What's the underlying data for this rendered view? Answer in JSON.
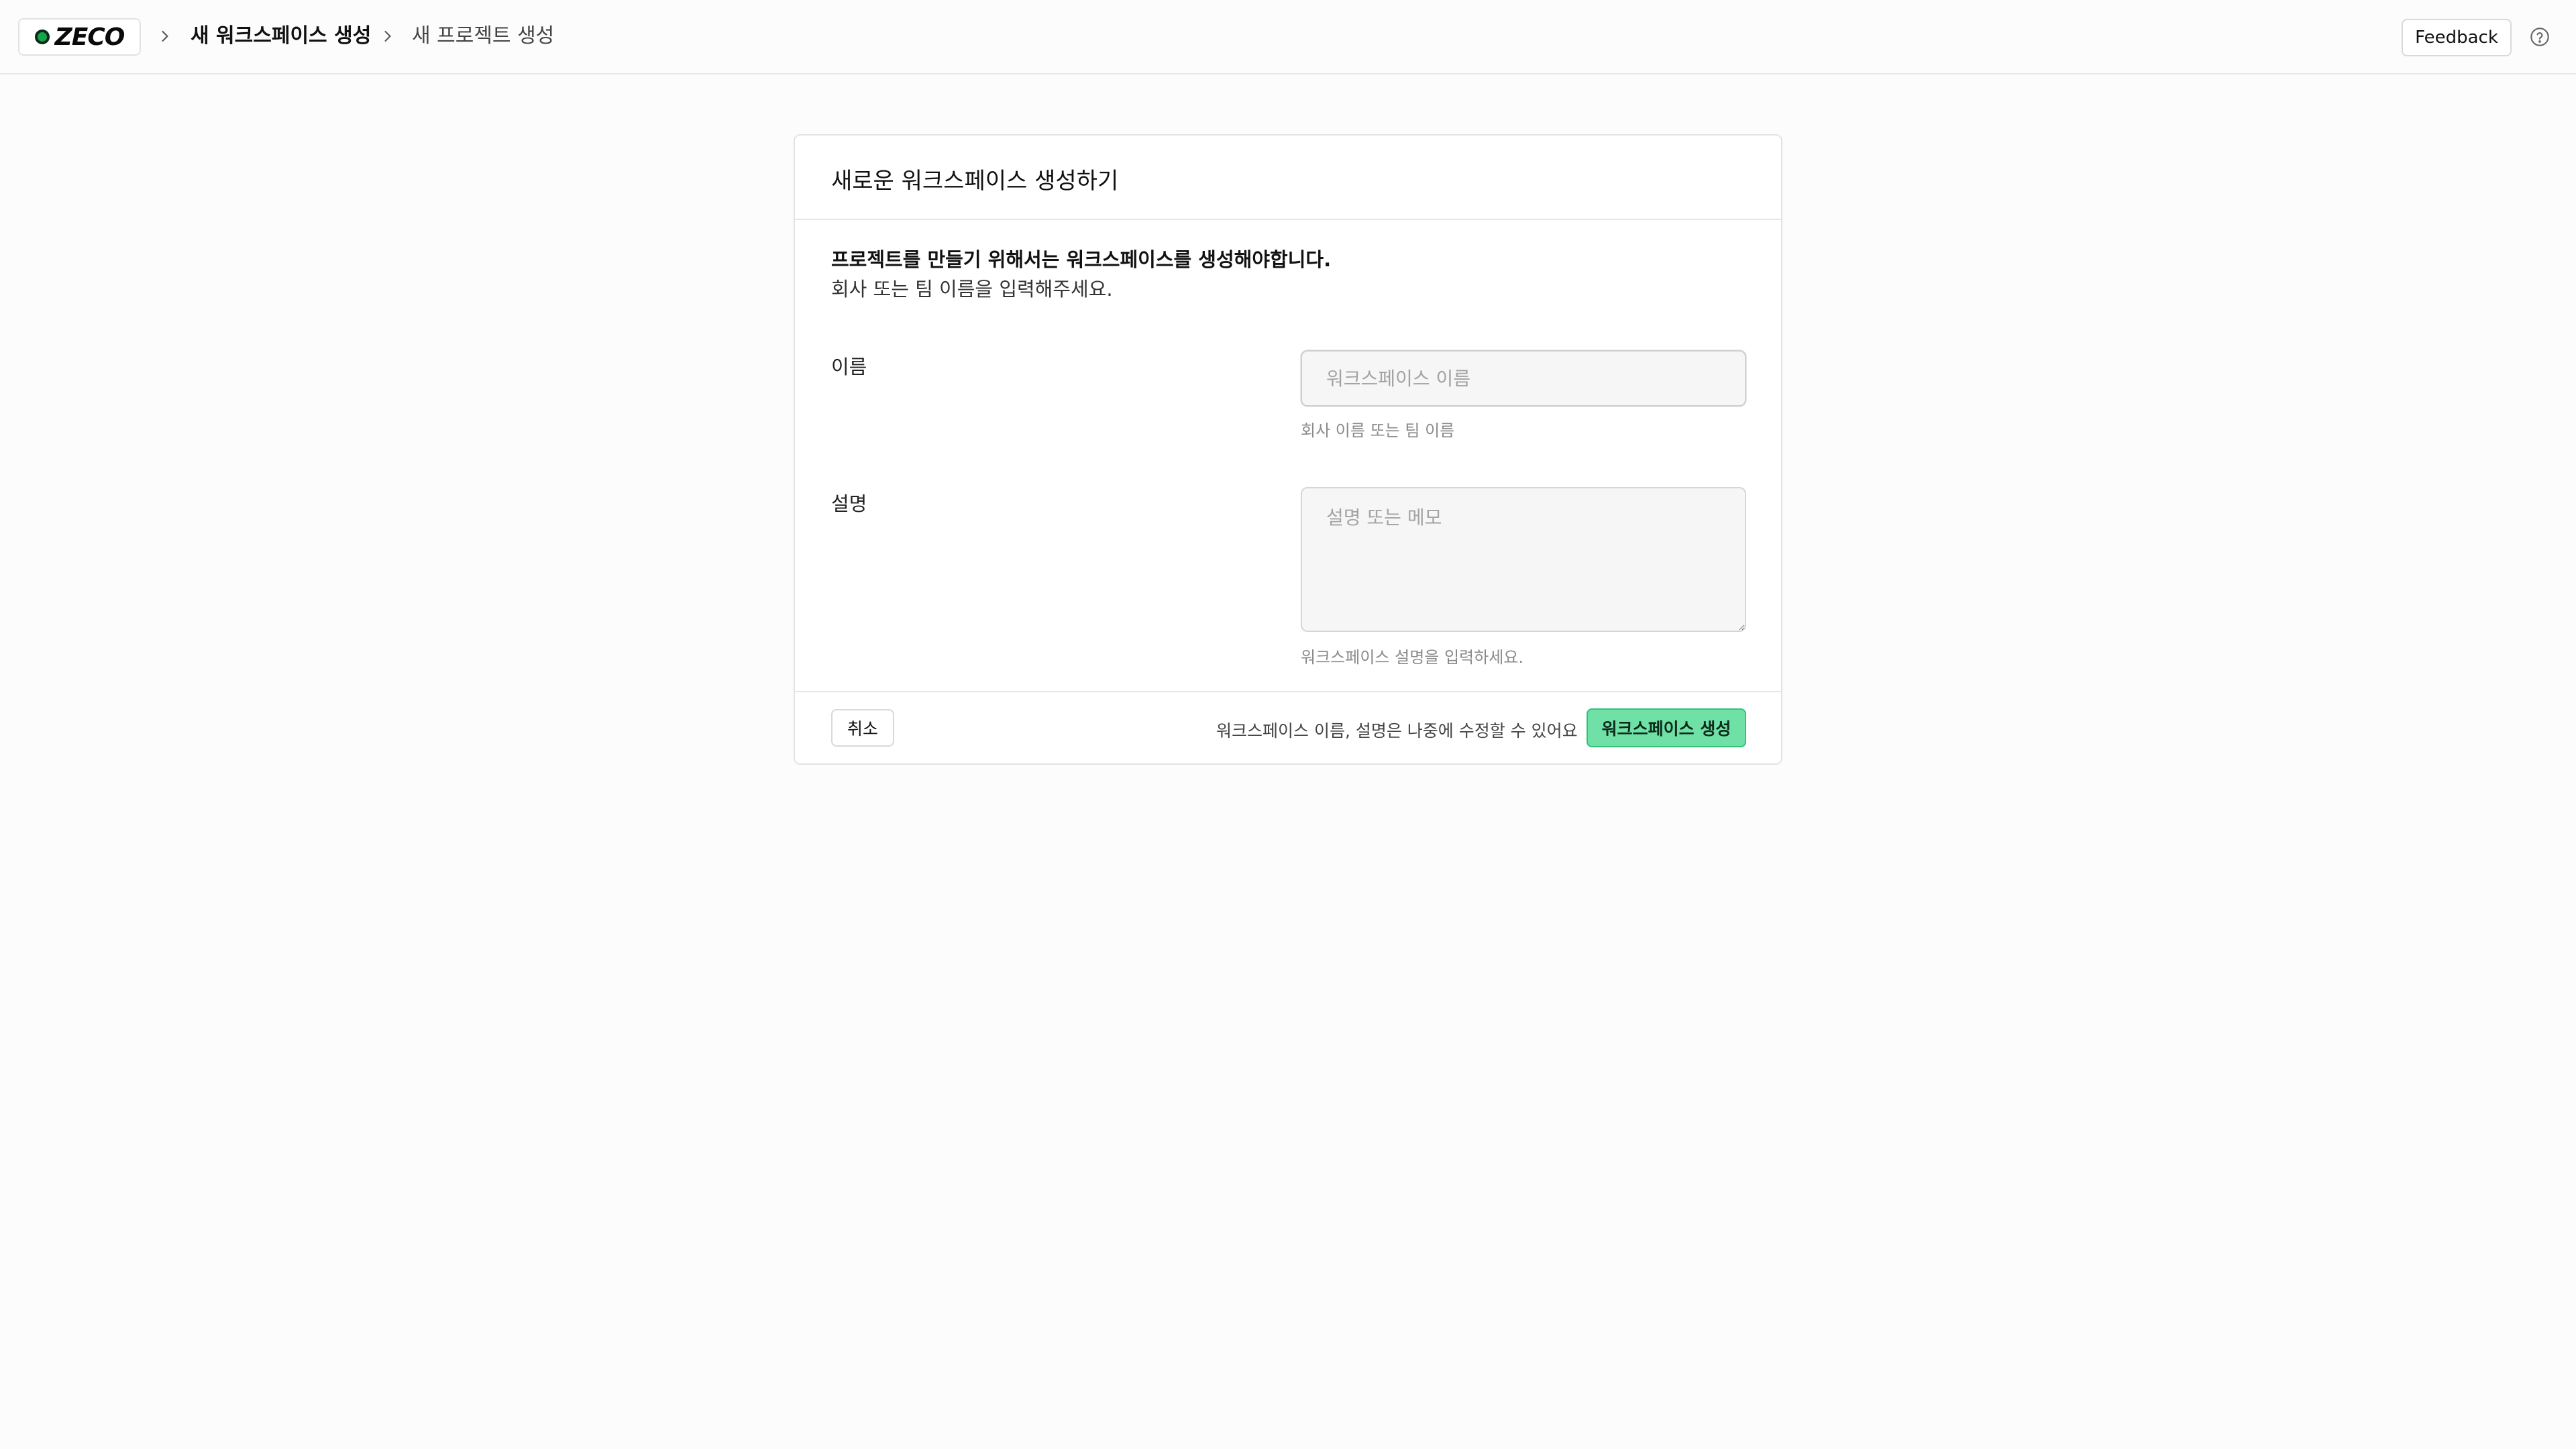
{
  "header": {
    "logo_text": "ZECO",
    "breadcrumbs": [
      {
        "label": "새 워크스페이스 생성"
      },
      {
        "label": "새 프로젝트 생성"
      }
    ],
    "feedback_label": "Feedback"
  },
  "card": {
    "title": "새로운 워크스페이스 생성하기",
    "intro_line1": "프로젝트를 만들기 위해서는 워크스페이스를 생성해야합니다.",
    "intro_line2": "회사 또는 팀 이름을 입력해주세요.",
    "name_field": {
      "label": "이름",
      "placeholder": "워크스페이스 이름",
      "value": "",
      "hint": "회사 이름 또는 팀 이름"
    },
    "description_field": {
      "label": "설명",
      "placeholder": "설명 또는 메모",
      "value": "",
      "hint": "워크스페이스 설명을 입력하세요."
    },
    "footer": {
      "cancel_label": "취소",
      "note": "워크스페이스 이름, 설명은 나중에 수정할 수 있어요",
      "create_label": "워크스페이스 생성"
    }
  },
  "colors": {
    "accent": "#6fe0a6",
    "accent_border": "#34c27a",
    "logo_dot": "#16a34a"
  },
  "icons": {
    "breadcrumb_separator": "chevron-right-icon",
    "help": "help-circle-icon"
  }
}
